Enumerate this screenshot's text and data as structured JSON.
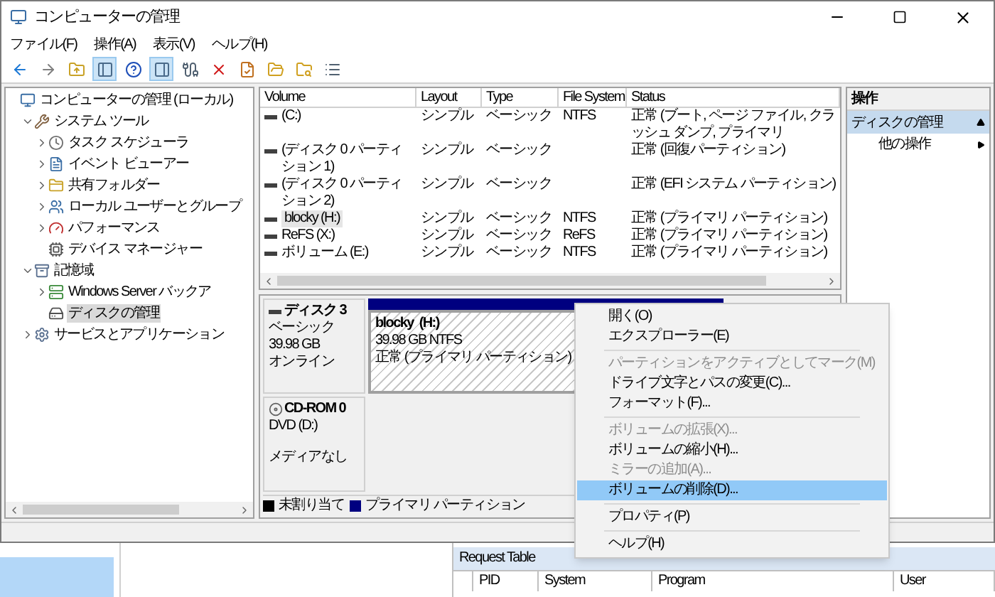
{
  "window": {
    "title": "コンピューターの管理"
  },
  "menu": [
    "ファイル(F)",
    "操作(A)",
    "表示(V)",
    "ヘルプ(H)"
  ],
  "toolbar": [
    {
      "kind": "back",
      "pressed": false
    },
    {
      "kind": "forward",
      "pressed": false
    },
    {
      "kind": "up",
      "pressed": false
    },
    {
      "kind": "tree",
      "pressed": true
    },
    {
      "kind": "help",
      "pressed": false
    },
    {
      "kind": "pane",
      "pressed": true
    },
    {
      "kind": "connect",
      "pressed": false
    },
    {
      "kind": "delete",
      "pressed": false
    },
    {
      "kind": "properties",
      "pressed": false
    },
    {
      "kind": "export",
      "pressed": false
    },
    {
      "kind": "find",
      "pressed": false
    },
    {
      "kind": "list",
      "pressed": false
    }
  ],
  "tree": [
    {
      "label": "コンピューターの管理 (ローカル)",
      "kind": "computer",
      "selected": false,
      "children": [
        {
          "label": "システム ツール",
          "kind": "tools",
          "expanded": true,
          "selected": false,
          "children": [
            {
              "label": "タスク スケジューラ",
              "kind": "clock",
              "expanded": false,
              "selected": false
            },
            {
              "label": "イベント ビューアー",
              "kind": "log",
              "expanded": false,
              "selected": false
            },
            {
              "label": "共有フォルダー",
              "kind": "share",
              "expanded": false,
              "selected": false
            },
            {
              "label": "ローカル ユーザーとグループ",
              "kind": "users",
              "expanded": false,
              "selected": false
            },
            {
              "label": "パフォーマンス",
              "kind": "gauge",
              "expanded": false,
              "selected": false
            },
            {
              "label": "デバイス マネージャー",
              "kind": "device",
              "selected": false
            }
          ]
        },
        {
          "label": "記憶域",
          "kind": "storage",
          "expanded": true,
          "selected": false,
          "children": [
            {
              "label": "Windows Server バックア",
              "kind": "backup",
              "expanded": false,
              "selected": false
            },
            {
              "label": "ディスクの管理",
              "kind": "disk",
              "selected": true
            }
          ]
        },
        {
          "label": "サービスとアプリケーション",
          "kind": "services",
          "expanded": false,
          "selected": false
        }
      ]
    }
  ],
  "volume_table": {
    "columns": [
      "Volume",
      "Layout",
      "Type",
      "File System",
      "Status"
    ],
    "rows": [
      {
        "volume": "(C:)",
        "layout": "シンプル",
        "type": "ベーシック",
        "file_system": "NTFS",
        "status": "正常 (ブート, ページ ファイル, クラッシュ ダンプ, プライマリ",
        "selected": false
      },
      {
        "volume": "(ディスク 0 パーティション 1)",
        "layout": "シンプル",
        "type": "ベーシック",
        "status": "正常 (回復パーティション)",
        "selected": false
      },
      {
        "volume": "(ディスク 0 パーティション 2)",
        "layout": "シンプル",
        "type": "ベーシック",
        "status": "正常 (EFI システム パーティション)",
        "selected": false
      },
      {
        "volume": "blocky (H:)",
        "layout": "シンプル",
        "type": "ベーシック",
        "file_system": "NTFS",
        "status": "正常 (プライマリ パーティション)",
        "selected": true
      },
      {
        "volume": "ReFS (X:)",
        "layout": "シンプル",
        "type": "ベーシック",
        "file_system": "ReFS",
        "status": "正常 (プライマリ パーティション)",
        "selected": false
      },
      {
        "volume": "ボリューム (E:)",
        "layout": "シンプル",
        "type": "ベーシック",
        "file_system": "NTFS",
        "status": "正常 (プライマリ パーティション)",
        "selected": false
      }
    ]
  },
  "disks": [
    {
      "kind": "disk",
      "name": "ディスク 3",
      "type": "ベーシック",
      "size": "39.98 GB",
      "status": "オンライン",
      "partitions": [
        {
          "name": "blocky  (H:)",
          "size_fs": "39.98 GB NTFS",
          "status": "正常 (プライマリ パーティション)",
          "color": "#000080",
          "selected": true
        }
      ]
    },
    {
      "kind": "cdrom",
      "name": "CD-ROM 0",
      "type": "DVD (D:)",
      "status": "メディアなし"
    }
  ],
  "legend": [
    {
      "label": "未割り当て",
      "color": "#000000"
    },
    {
      "label": "プライマリ パーティション",
      "color": "#000080"
    }
  ],
  "actions": {
    "title": "操作",
    "section": {
      "label": "ディスクの管理",
      "expanded": true
    },
    "items": [
      "他の操作"
    ]
  },
  "context_menu": [
    {
      "kind": "item",
      "label": "開く(O)",
      "disabled": false,
      "selected": false
    },
    {
      "kind": "item",
      "label": "エクスプローラー(E)",
      "disabled": false,
      "selected": false
    },
    {
      "kind": "separator"
    },
    {
      "kind": "item",
      "label": "パーティションをアクティブとしてマーク(M)",
      "disabled": true,
      "selected": false
    },
    {
      "kind": "item",
      "label": "ドライブ文字とパスの変更(C)...",
      "disabled": false,
      "selected": false
    },
    {
      "kind": "item",
      "label": "フォーマット(F)...",
      "disabled": false,
      "selected": false
    },
    {
      "kind": "separator"
    },
    {
      "kind": "item",
      "label": "ボリュームの拡張(X)...",
      "disabled": true,
      "selected": false
    },
    {
      "kind": "item",
      "label": "ボリュームの縮小(H)...",
      "disabled": false,
      "selected": false
    },
    {
      "kind": "item",
      "label": "ミラーの追加(A)...",
      "disabled": true,
      "selected": false
    },
    {
      "kind": "item",
      "label": "ボリュームの削除(D)...",
      "disabled": false,
      "selected": true
    },
    {
      "kind": "separator"
    },
    {
      "kind": "item",
      "label": "プロパティ(P)",
      "disabled": false,
      "selected": false
    },
    {
      "kind": "separator"
    },
    {
      "kind": "item",
      "label": "ヘルプ(H)",
      "disabled": false,
      "selected": false
    }
  ],
  "background_app": {
    "request_table": {
      "title": "Request Table",
      "columns": [
        "PID",
        "System",
        "Program",
        "User"
      ]
    }
  }
}
